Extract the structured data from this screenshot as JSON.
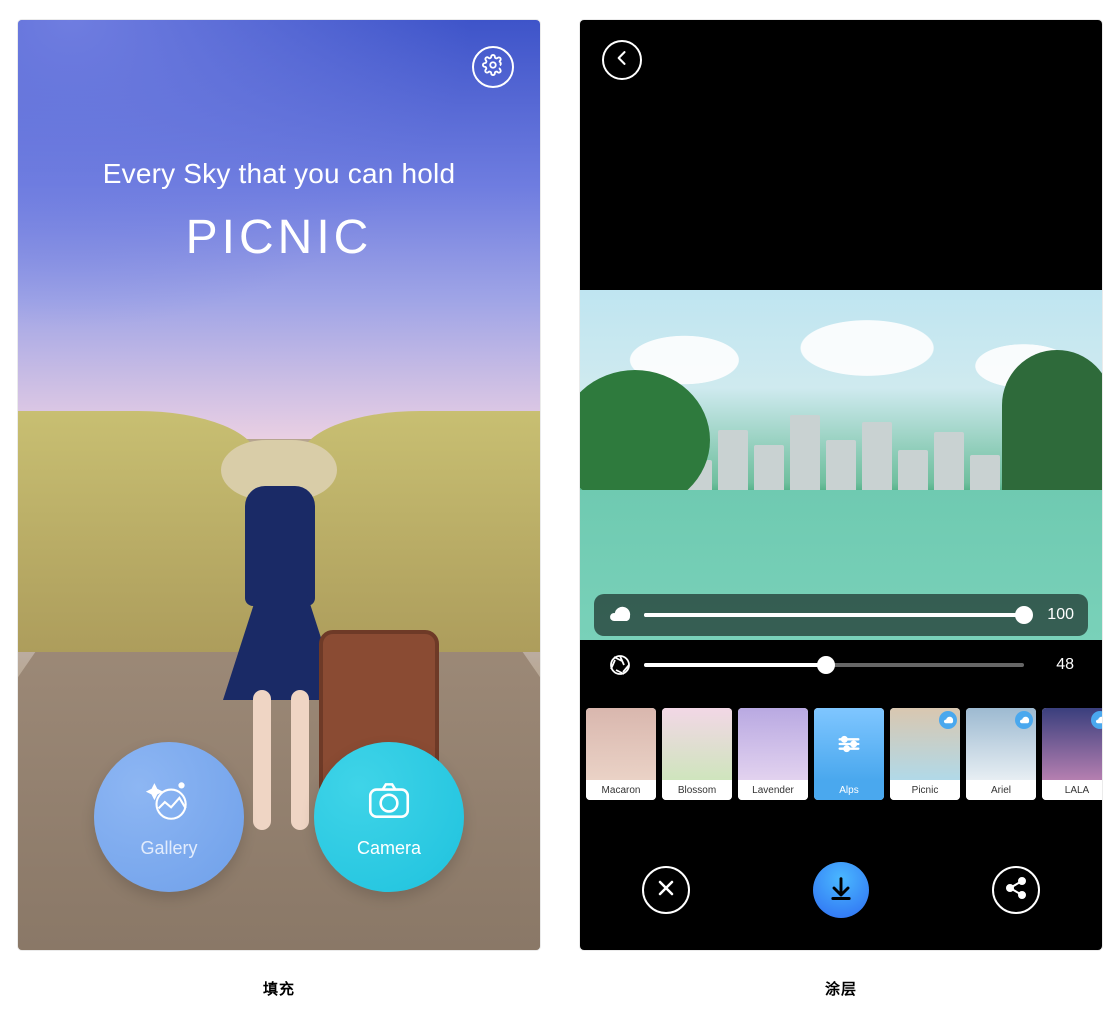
{
  "captions": {
    "left": "填充",
    "right": "涂层"
  },
  "home": {
    "tagline": "Every Sky that you can hold",
    "brand": "PICNIC",
    "buttons": {
      "gallery": {
        "label": "Gallery",
        "icon": "gallery-sparkle-icon"
      },
      "camera": {
        "label": "Camera",
        "icon": "camera-icon"
      }
    },
    "settings_icon": "gear-icon"
  },
  "editor": {
    "back_icon": "arrow-left-icon",
    "sliders": {
      "cloud": {
        "icon": "cloud-icon",
        "value": 100,
        "min": 0,
        "max": 100
      },
      "aperture": {
        "icon": "aperture-icon",
        "value": 48,
        "min": 0,
        "max": 100
      }
    },
    "filters": [
      {
        "label": "Macaron",
        "has_cloud_badge": false,
        "selected": false,
        "swatch": [
          "#d9b7ae",
          "#ead2c6"
        ]
      },
      {
        "label": "Blossom",
        "has_cloud_badge": false,
        "selected": false,
        "swatch": [
          "#f2d7e6",
          "#cfe5bd"
        ]
      },
      {
        "label": "Lavender",
        "has_cloud_badge": false,
        "selected": false,
        "swatch": [
          "#b9a9e2",
          "#e2d2ef"
        ]
      },
      {
        "label": "Alps",
        "has_cloud_badge": false,
        "selected": true,
        "swatch": [
          "#7fc6ff",
          "#4aa8ee"
        ]
      },
      {
        "label": "Picnic",
        "has_cloud_badge": true,
        "selected": false,
        "swatch": [
          "#d9c7b0",
          "#b1d9e8"
        ]
      },
      {
        "label": "Ariel",
        "has_cloud_badge": true,
        "selected": false,
        "swatch": [
          "#9dbad1",
          "#e7eef3"
        ]
      },
      {
        "label": "LALA",
        "has_cloud_badge": true,
        "selected": false,
        "swatch": [
          "#3a3f7d",
          "#b57fb0"
        ]
      }
    ],
    "bottom_bar": {
      "cancel": {
        "icon": "close-icon"
      },
      "download": {
        "icon": "download-icon"
      },
      "share": {
        "icon": "share-icon"
      }
    }
  }
}
